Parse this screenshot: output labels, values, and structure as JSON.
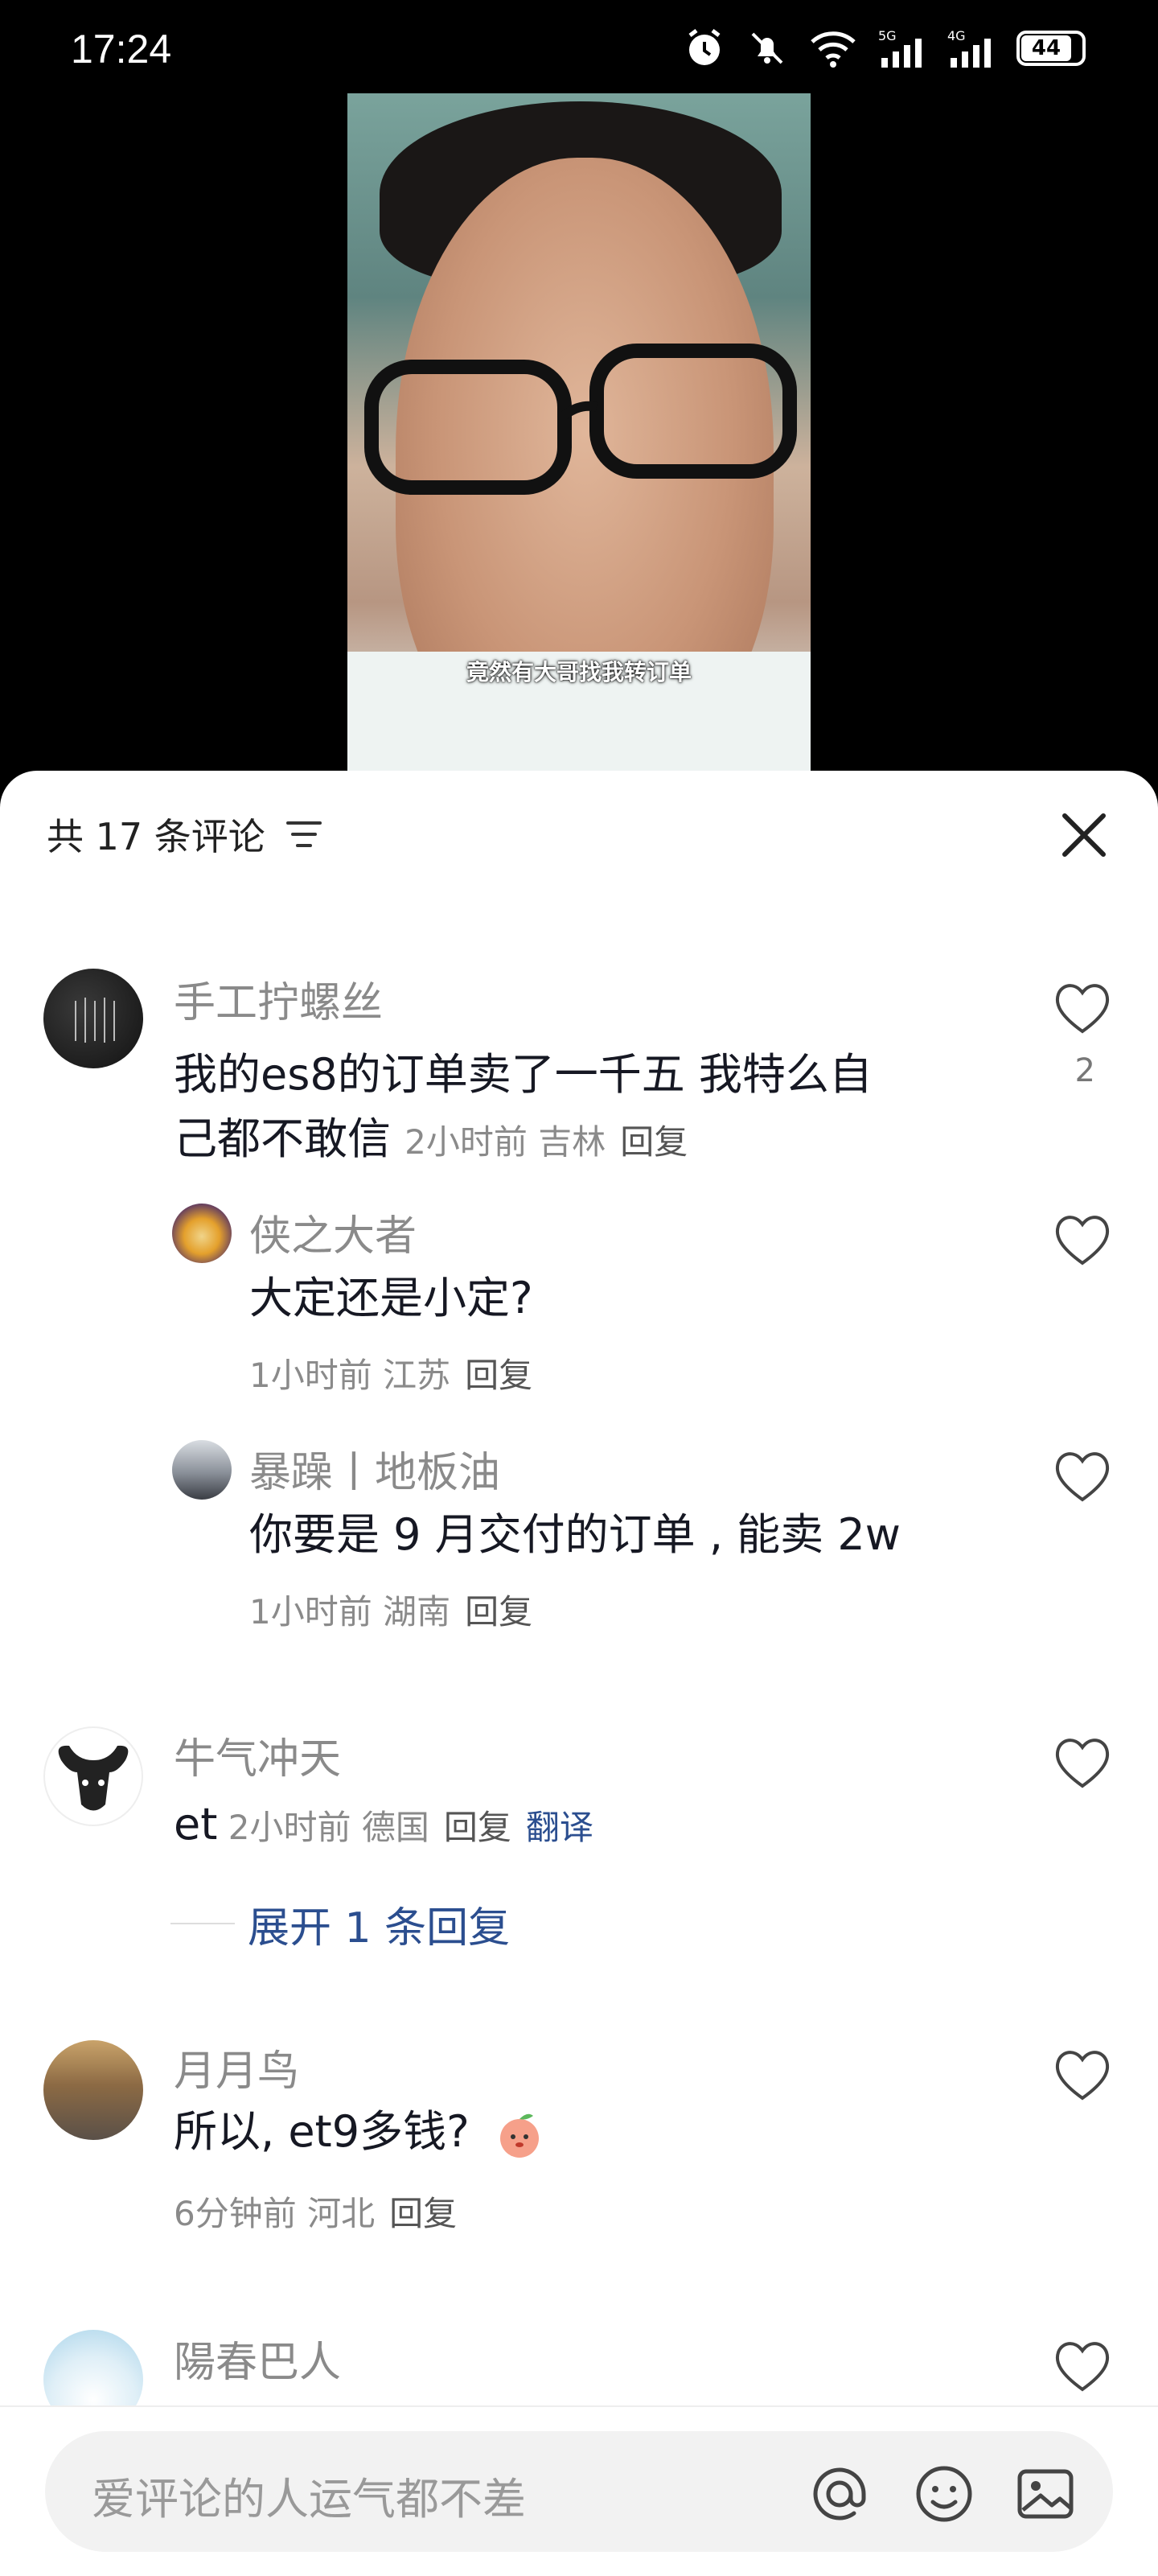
{
  "status_bar": {
    "time": "17:24",
    "battery": "44"
  },
  "video": {
    "subtitle": "竟然有大哥找我转订单"
  },
  "comments_header": {
    "title": "共 17 条评论"
  },
  "comments": [
    {
      "user": "手工拧螺丝",
      "text": "我的es8的订单卖了一千五 我特么自己都不敢信",
      "line1": "我的es8的订单卖了一千五 我特么自",
      "line2_prefix": "己都不敢信",
      "meta": "2小时前 吉林",
      "reply": "回复",
      "likes": "2"
    },
    {
      "user": "侠之大者",
      "text": "大定还是小定?",
      "meta": "1小时前 江苏",
      "reply": "回复"
    },
    {
      "user": "暴躁丨地板油",
      "text": "你要是 9 月交付的订单 , 能卖 2w",
      "meta": "1小时前 湖南",
      "reply": "回复"
    },
    {
      "user": "牛气冲天",
      "text": "et",
      "meta": "2小时前 德国",
      "reply": "回复",
      "translate": "翻译",
      "expand": "展开 1 条回复"
    },
    {
      "user": "月月鸟",
      "text": "所以, et9多钱?",
      "meta": "6分钟前 河北",
      "reply": "回复"
    },
    {
      "user": "陽春巴人"
    }
  ],
  "input": {
    "placeholder": "爱评论的人运气都不差"
  }
}
